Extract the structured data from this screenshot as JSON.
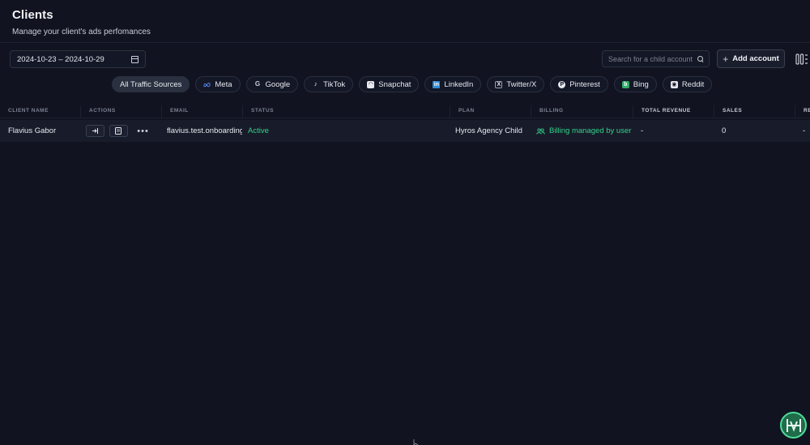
{
  "header": {
    "title": "Clients",
    "subtitle": "Manage your client's ads perfomances"
  },
  "toolbar": {
    "date_range": "2024-10-23 – 2024-10-29",
    "search_placeholder": "Search for a child account",
    "add_account_label": "Add account"
  },
  "filters": [
    {
      "label": "All Traffic Sources",
      "icon": "none",
      "active": true
    },
    {
      "label": "Meta",
      "icon": "meta-icon",
      "active": false
    },
    {
      "label": "Google",
      "icon": "google-icon",
      "active": false
    },
    {
      "label": "TikTok",
      "icon": "tiktok-icon",
      "active": false
    },
    {
      "label": "Snapchat",
      "icon": "snapchat-icon",
      "active": false
    },
    {
      "label": "LinkedIn",
      "icon": "linkedin-icon",
      "active": false
    },
    {
      "label": "Twitter/X",
      "icon": "twitter-x-icon",
      "active": false
    },
    {
      "label": "Pinterest",
      "icon": "pinterest-icon",
      "active": false
    },
    {
      "label": "Bing",
      "icon": "bing-icon",
      "active": false
    },
    {
      "label": "Reddit",
      "icon": "reddit-icon",
      "active": false
    }
  ],
  "table": {
    "columns": [
      "Client Name",
      "Actions",
      "Email",
      "Status",
      "Plan",
      "Billing",
      "Total Revenue",
      "Sales",
      "Re"
    ],
    "rows": [
      {
        "client_name": "Flavius Gabor",
        "email": "flavius.test.onboarding",
        "status": "Active",
        "plan": "Hyros Agency Child",
        "billing": "Billing managed by user",
        "total_revenue": "-",
        "sales": "0",
        "re": "-"
      }
    ]
  },
  "colors": {
    "background": "#111420",
    "accent_green": "#35d08a",
    "row_background": "#181c2a"
  }
}
